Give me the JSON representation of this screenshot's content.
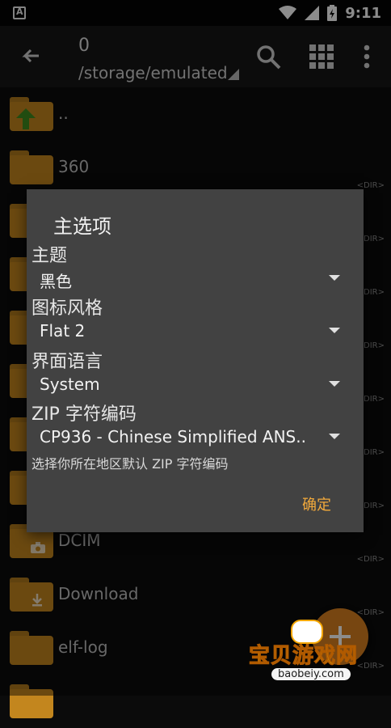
{
  "statusbar": {
    "left_badge": "A",
    "time": "9:11"
  },
  "appbar": {
    "count": "0",
    "path": "/storage/emulated"
  },
  "list": {
    "dir_tag": "<DIR>",
    "items": [
      {
        "label": "..",
        "kind": "up"
      },
      {
        "label": "360",
        "kind": "folder"
      },
      {
        "label": "",
        "kind": "folder"
      },
      {
        "label": "",
        "kind": "folder"
      },
      {
        "label": "",
        "kind": "folder"
      },
      {
        "label": "",
        "kind": "folder"
      },
      {
        "label": "",
        "kind": "folder"
      },
      {
        "label": "",
        "kind": "folder"
      },
      {
        "label": "DCIM",
        "kind": "camera"
      },
      {
        "label": "Download",
        "kind": "download"
      },
      {
        "label": "elf-log",
        "kind": "folder"
      }
    ]
  },
  "dialog": {
    "title": "主选项",
    "theme_label": "主题",
    "theme_value": "黑色",
    "icon_style_label": "图标风格",
    "icon_style_value": "Flat 2",
    "language_label": "界面语言",
    "language_value": "System",
    "zip_label": "ZIP 字符编码",
    "zip_value": "CP936 - Chinese Simplified ANS..",
    "zip_hint": "选择你所在地区默认 ZIP 字符编码",
    "ok_label": "确定"
  },
  "watermark": {
    "text": "宝贝游戏网",
    "url": "baobeiy.com"
  },
  "colors": {
    "accent": "#f2a93b",
    "folder": "#c3861e",
    "dialog_bg": "#424242",
    "fab": "#d9801f"
  }
}
